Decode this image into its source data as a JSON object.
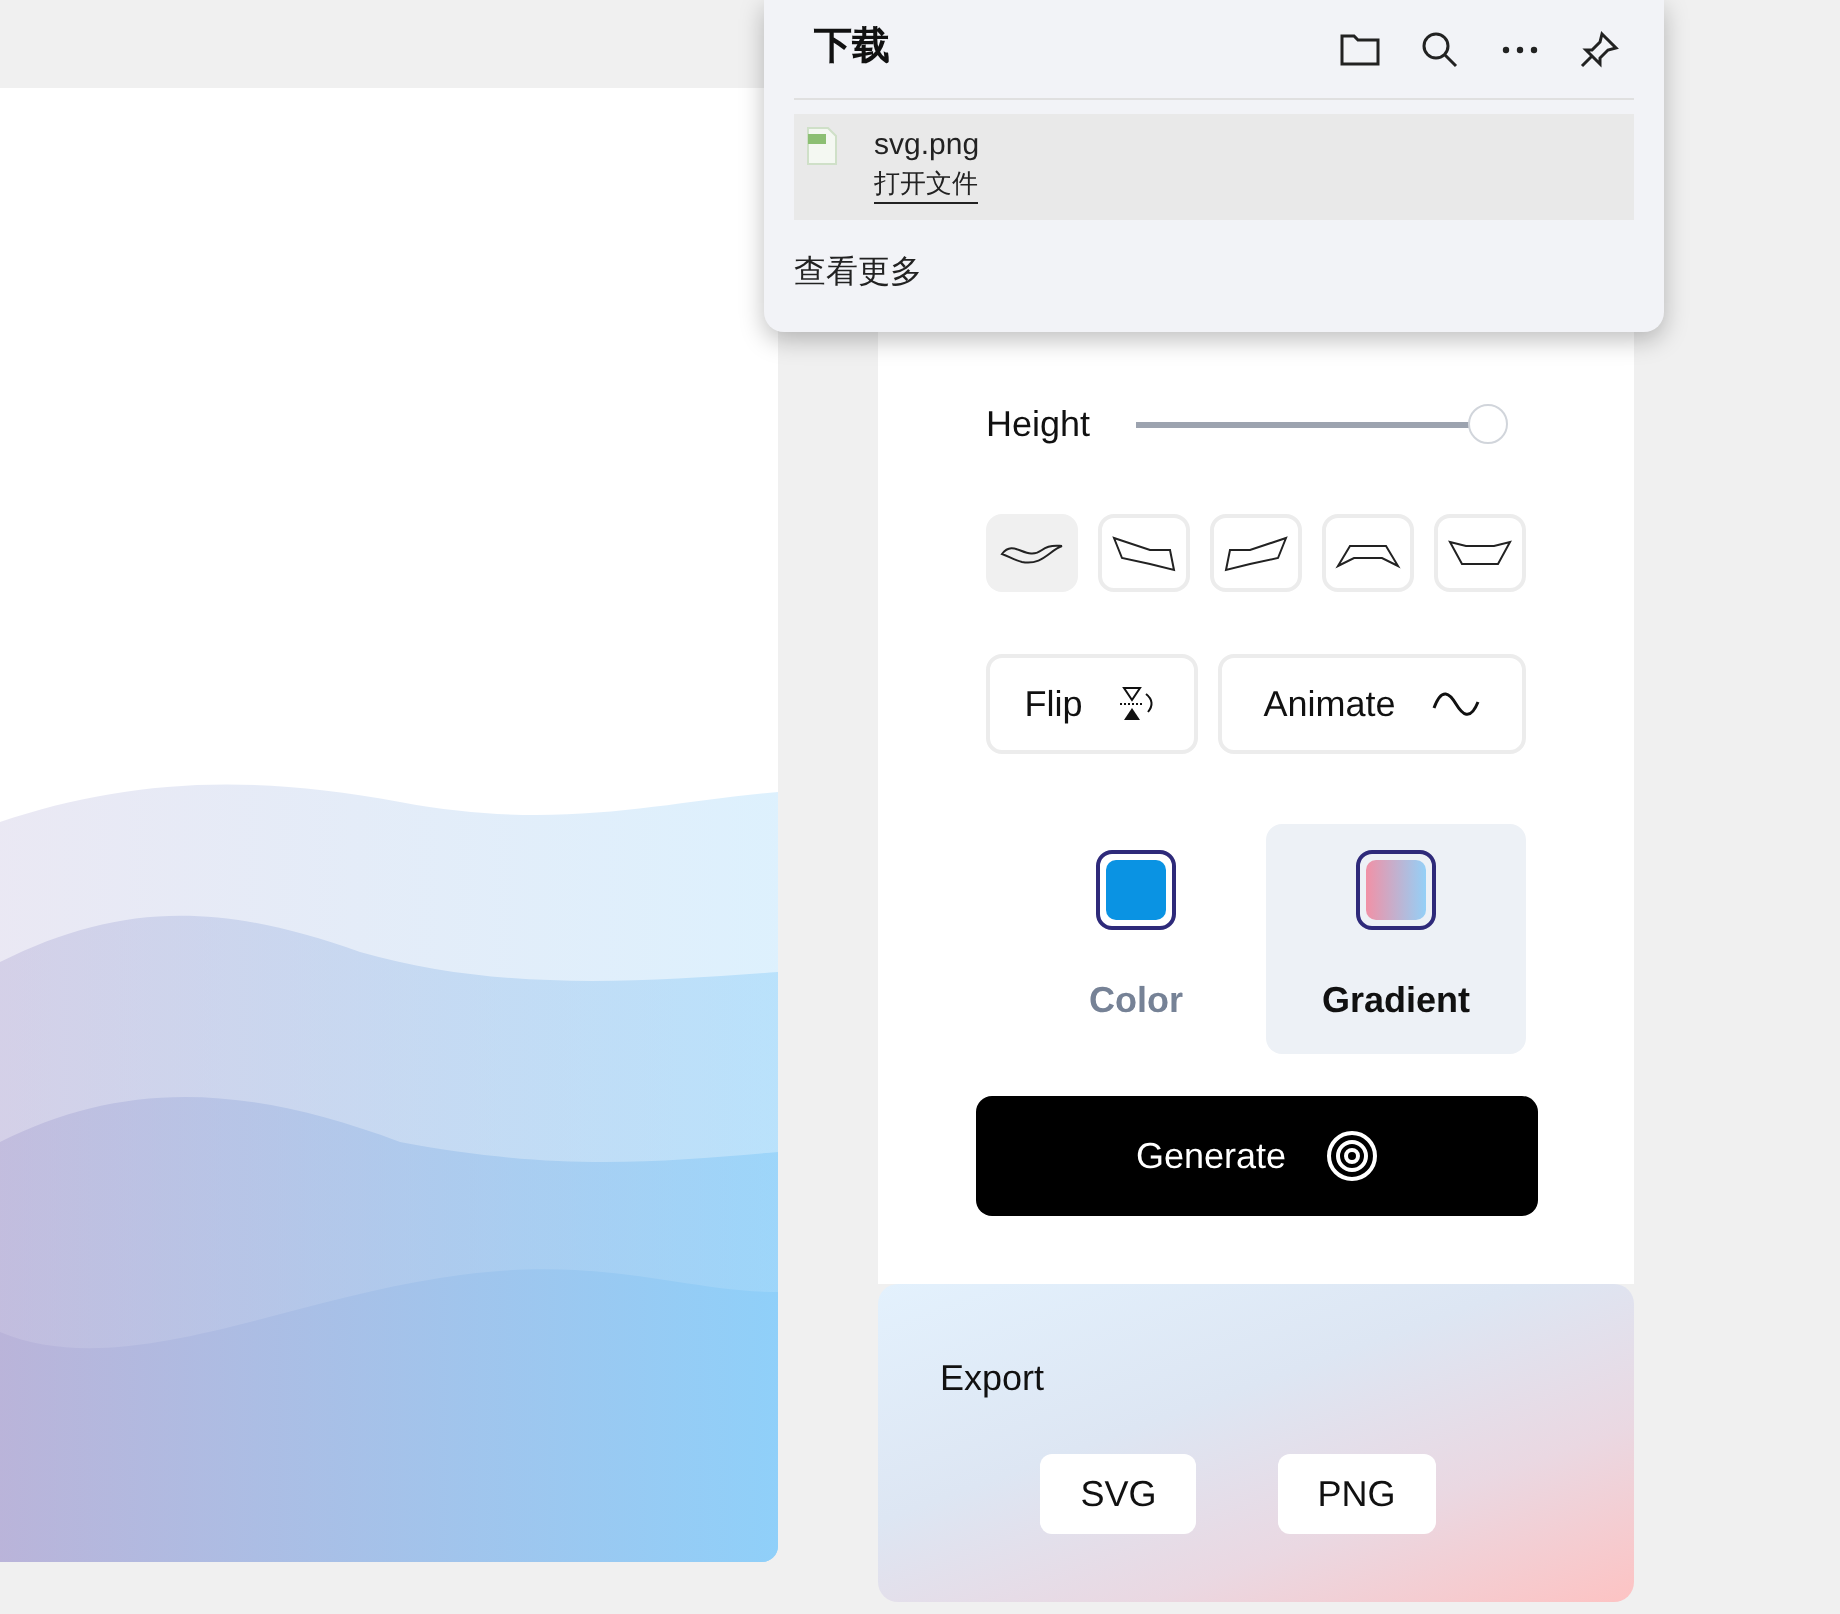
{
  "downloads": {
    "title": "下载",
    "items": [
      {
        "name": "svg.png",
        "action": "打开文件"
      }
    ],
    "more": "查看更多"
  },
  "controls": {
    "sliders": [
      {
        "label": "Height",
        "level": 1
      }
    ],
    "shapes": [
      {
        "kind": "wave",
        "selected": true
      },
      {
        "kind": "tilt-down",
        "selected": false
      },
      {
        "kind": "tilt-up",
        "selected": false
      },
      {
        "kind": "arch",
        "selected": false
      },
      {
        "kind": "bowl",
        "selected": false
      }
    ],
    "toggles": [
      {
        "label": "Flip",
        "kind": "flip"
      },
      {
        "label": "Animate",
        "kind": "animate"
      }
    ],
    "fill_modes": [
      {
        "label": "Color",
        "kind": "solid",
        "selected": false
      },
      {
        "label": "Gradient",
        "kind": "gradient",
        "selected": true
      }
    ],
    "generate": "Generate"
  },
  "export": {
    "title": "Export",
    "formats": [
      "SVG",
      "PNG"
    ]
  }
}
